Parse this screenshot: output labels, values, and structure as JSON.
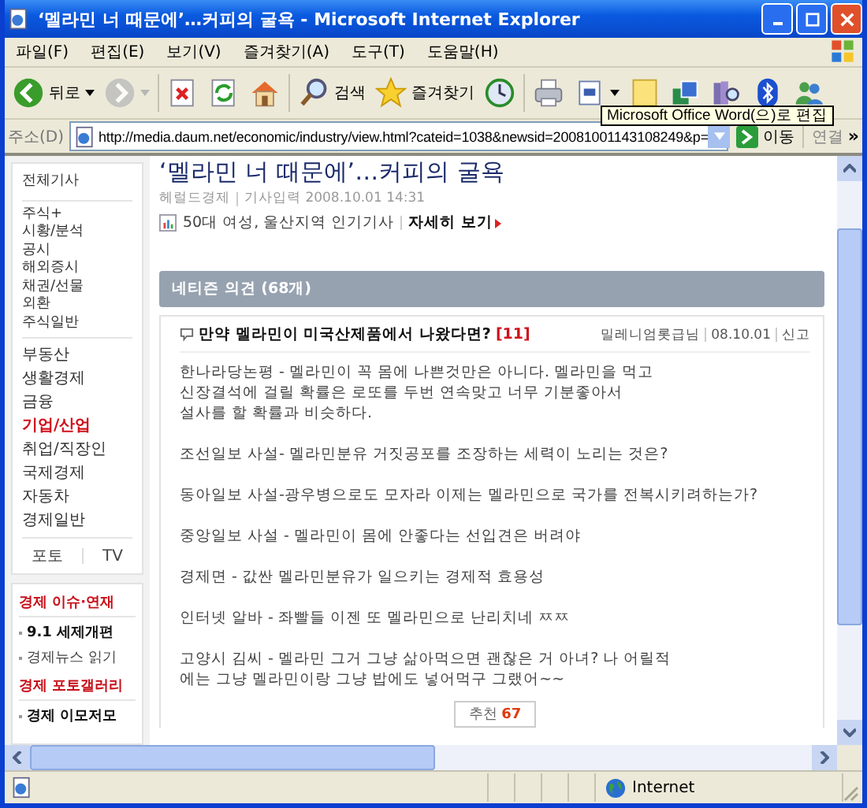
{
  "window": {
    "title": "‘멜라민 너 때문에’…커피의 굴욕 - Microsoft Internet Explorer"
  },
  "menu_bar": [
    "파일(F)",
    "편집(E)",
    "보기(V)",
    "즐겨찾기(A)",
    "도구(T)",
    "도움말(H)"
  ],
  "toolbar": [
    {
      "kind": "back",
      "label": "뒤로",
      "dropdown": true,
      "disabled": false
    },
    {
      "kind": "forward",
      "dropdown": true,
      "disabled": true
    },
    {
      "kind": "stop",
      "dropdown": false,
      "disabled": false
    },
    {
      "kind": "refresh",
      "dropdown": false,
      "disabled": false
    },
    {
      "kind": "home",
      "dropdown": false,
      "disabled": false
    },
    {
      "kind": "search",
      "label": "검색",
      "dropdown": false,
      "disabled": false
    },
    {
      "kind": "favorites",
      "label": "즐겨찾기",
      "dropdown": false,
      "disabled": false
    },
    {
      "kind": "history",
      "dropdown": false,
      "disabled": false
    },
    {
      "kind": "print",
      "dropdown": false,
      "disabled": false
    },
    {
      "kind": "edit",
      "dropdown": true,
      "disabled": false
    },
    {
      "kind": "note",
      "dropdown": false,
      "disabled": false
    },
    {
      "kind": "network",
      "dropdown": false,
      "disabled": false
    },
    {
      "kind": "research",
      "dropdown": false,
      "disabled": false
    },
    {
      "kind": "bluetooth",
      "dropdown": false,
      "disabled": false
    },
    {
      "kind": "messenger",
      "dropdown": false,
      "disabled": false
    }
  ],
  "tooltip": "Microsoft Office Word(으)로 편집",
  "address_bar": {
    "label": "주소(D)",
    "url": "http://media.daum.net/economic/industry/view.html?cateid=1038&newsid=20081001143108249&p=",
    "go": "이동",
    "links": "연결",
    "more": "»"
  },
  "sidebar": {
    "groups": [
      [
        {
          "label": "전체기사",
          "selected": false
        }
      ],
      [
        {
          "label": "주식+",
          "selected": false
        },
        {
          "label": "시황/분석",
          "selected": false
        },
        {
          "label": "공시",
          "selected": false
        },
        {
          "label": "해외증시",
          "selected": false
        },
        {
          "label": "채권/선물",
          "selected": false
        },
        {
          "label": "외환",
          "selected": false
        },
        {
          "label": "주식일반",
          "selected": false
        }
      ],
      [
        {
          "label": "부동산",
          "selected": false
        },
        {
          "label": "생활경제",
          "selected": false
        },
        {
          "label": "금융",
          "selected": false
        },
        {
          "label": "기업/산업",
          "selected": true
        },
        {
          "label": "취업/직장인",
          "selected": false
        },
        {
          "label": "국제경제",
          "selected": false
        },
        {
          "label": "자동차",
          "selected": false
        },
        {
          "label": "경제일반",
          "selected": false
        }
      ]
    ],
    "tabs": [
      "포토",
      "TV"
    ],
    "sections": [
      {
        "heading": "경제 이슈·연재",
        "items": [
          {
            "label": "9.1 세제개편",
            "highlighted": true
          },
          {
            "label": "경제뉴스 읽기",
            "highlighted": false
          }
        ]
      },
      {
        "heading": "경제 포토갤러리",
        "items": [
          {
            "label": "경제 이모저모",
            "highlighted": true
          }
        ]
      }
    ]
  },
  "article": {
    "title": "‘멜라민 너 때문에’…커피의 굴욕",
    "source": "헤럴드경제",
    "published": "기사입력 2008.10.01 14:31",
    "popular": "50대 여성, 울산지역 인기기사",
    "popular_link": "자세히 보기"
  },
  "comments": {
    "header": "네티즌 의견 (68개)",
    "comment": {
      "title": "만약 멜라민이 미국산제품에서 나왔다면?",
      "replies": "[11]",
      "author": "밀레니엄롯급님",
      "date": "08.10.01",
      "report": "신고",
      "paragraphs": [
        [
          "한나라당논평 - 멜라민이 꼭 몸에 나쁜것만은 아니다. 멜라민을 먹고",
          "신장결석에 걸릴 확률은 로또를 두번 연속맞고 너무 기분좋아서",
          "설사를 할 확률과 비슷하다."
        ],
        [
          "조선일보 사설- 멜라민분유 거짓공포를 조장하는 세력이 노리는 것은?"
        ],
        [
          "동아일보 사설-광우병으로도 모자라 이제는 멜라민으로 국가를 전복시키려하는가?"
        ],
        [
          "중앙일보 사설 - 멜라민이 몸에 안좋다는 선입견은 버려야"
        ],
        [
          "경제면 - 값싼 멜라민분유가 일으키는 경제적 효용성"
        ],
        [
          "인터넷 알바 - 좌빨들 이젠 또 멜라민으로 난리치네 ㅉㅉ"
        ],
        [
          "고양시 김씨 - 멜라민 그거 그냥 삶아먹으면 괜찮은 거 아녀? 나 어릴적",
          "에는 그냥 멜라민이랑 그냥 밥에도 넣어먹구 그랬어~~"
        ]
      ],
      "recommend": "추천",
      "recommend_count": "67"
    }
  },
  "status_bar": {
    "zone": "Internet"
  }
}
